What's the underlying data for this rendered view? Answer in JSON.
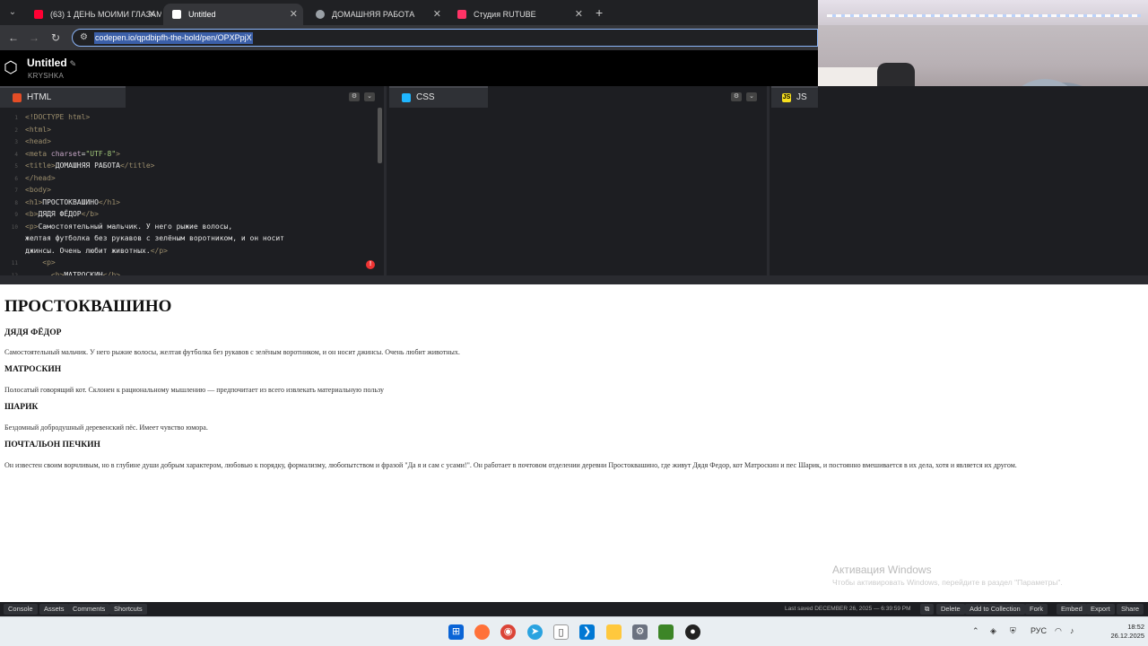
{
  "browser": {
    "tabs": [
      {
        "title": "(63) 1 ДЕНЬ МОИМИ ГЛАЗАМ",
        "favicon_color": "#ff0033",
        "active": false
      },
      {
        "title": "Untitled",
        "favicon_color": "#ffffff",
        "active": true
      },
      {
        "title": "ДОМАШНЯЯ РАБОТА",
        "favicon_color": "#9aa0a6",
        "active": false
      },
      {
        "title": "Студия RUTUBE",
        "favicon_color": "#ff3366",
        "active": false
      }
    ],
    "new_tab": "+",
    "url": "codepen.io/qpdbipfh-the-bold/pen/OPXPpjX"
  },
  "codepen": {
    "title": "Untitled",
    "user": "KRYSHKA",
    "panes": [
      {
        "label": "HTML",
        "badge_color": "#e44d26",
        "badge_text": ""
      },
      {
        "label": "CSS",
        "badge_color": "#1fb6ff",
        "badge_text": ""
      },
      {
        "label": "JS",
        "badge_color": "#f7df1e",
        "badge_text": "JS"
      }
    ],
    "code_lines": [
      {
        "n": "1",
        "parts": [
          [
            "tag",
            "<!DOCTYPE html>"
          ]
        ]
      },
      {
        "n": "2",
        "parts": [
          [
            "tag",
            "<html>"
          ]
        ]
      },
      {
        "n": "3",
        "parts": [
          [
            "tag",
            "<head>"
          ]
        ]
      },
      {
        "n": "4",
        "parts": [
          [
            "tag",
            "<meta "
          ],
          [
            "attr",
            "charset"
          ],
          [
            "txt",
            "="
          ],
          [
            "val",
            "\"UTF-8\""
          ],
          [
            "tag",
            ">"
          ]
        ]
      },
      {
        "n": "5",
        "parts": [
          [
            "tag",
            "<title>"
          ],
          [
            "txt",
            "ДОМАШНЯЯ РАБОТА"
          ],
          [
            "tag",
            "</title>"
          ]
        ]
      },
      {
        "n": "6",
        "parts": [
          [
            "tag",
            "</head>"
          ]
        ]
      },
      {
        "n": "7",
        "parts": [
          [
            "tag",
            "<body>"
          ]
        ]
      },
      {
        "n": "8",
        "parts": [
          [
            "tag",
            "<h1>"
          ],
          [
            "txt",
            "ПРОСТОКВАШИНО"
          ],
          [
            "tag",
            "</h1>"
          ]
        ]
      },
      {
        "n": "9",
        "parts": [
          [
            "tag",
            "<b>"
          ],
          [
            "txt",
            "ДЯДЯ ФЁДОР"
          ],
          [
            "tag",
            "</b>"
          ]
        ]
      },
      {
        "n": "10",
        "parts": [
          [
            "tag",
            "<p>"
          ],
          [
            "txt",
            "Самостоятельный мальчик. У него рыжие волосы,"
          ]
        ]
      },
      {
        "n": "",
        "parts": [
          [
            "txt",
            "желтая футболка без рукавов с зелёным воротником, и он носит"
          ]
        ]
      },
      {
        "n": "",
        "parts": [
          [
            "txt",
            "джинсы. Очень любит животных."
          ],
          [
            "tag",
            "</p>"
          ]
        ]
      },
      {
        "n": "11",
        "parts": [
          [
            "txt",
            "    "
          ],
          [
            "tag",
            "<p>"
          ]
        ]
      },
      {
        "n": "12",
        "parts": [
          [
            "txt",
            "      "
          ],
          [
            "tag",
            "<b>"
          ],
          [
            "txt",
            "МАТРОСКИН"
          ],
          [
            "tag",
            "</b>"
          ]
        ]
      }
    ],
    "error_count": "!"
  },
  "preview": {
    "h1": "ПРОСТОКВАШИНО",
    "sections": [
      {
        "name": "ДЯДЯ ФЁДОР",
        "text": "Самостоятельный мальчик. У него рыжие волосы, желтая футболка без рукавов с зелёным воротником, и он носит джинсы. Очень любит животных."
      },
      {
        "name": "МАТРОСКИН",
        "text": "Полосатый говорящий кот. Склонен к рациональному мышлению — предпочитает из всего извлекать материальную пользу"
      },
      {
        "name": "ШАРИК",
        "text": "Бездомный добродушный деревенский пёс. Имеет чувство юмора."
      },
      {
        "name": "ПОЧТАЛЬОН ПЕЧКИН",
        "text": "Он известен своим ворчливым, но в глубине души добрым характером, любовью к порядку, формализму, любопытством и фразой \"Да я и сам с усами!\". Он работает в почтовом отделении деревни Простоквашино, где живут Дядя Федор, кот Матроскин и пес Шарик, и постоянно вмешивается в их дела, хотя и является их другом."
      }
    ],
    "watermark_title": "Активация Windows",
    "watermark_sub": "Чтобы активировать Windows, перейдите в раздел \"Параметры\"."
  },
  "footer": {
    "left_buttons": [
      "Console",
      "Assets",
      "Comments",
      "Shortcuts"
    ],
    "saved": "Last saved DECEMBER 26, 2025 — 6:39:59 PM",
    "right_buttons": [
      "Delete",
      "Add to Collection",
      "Fork",
      "Embed",
      "Export",
      "Share"
    ]
  },
  "taskbar": {
    "lang": "РУС",
    "time": "18:52",
    "date": "26.12.2025"
  }
}
